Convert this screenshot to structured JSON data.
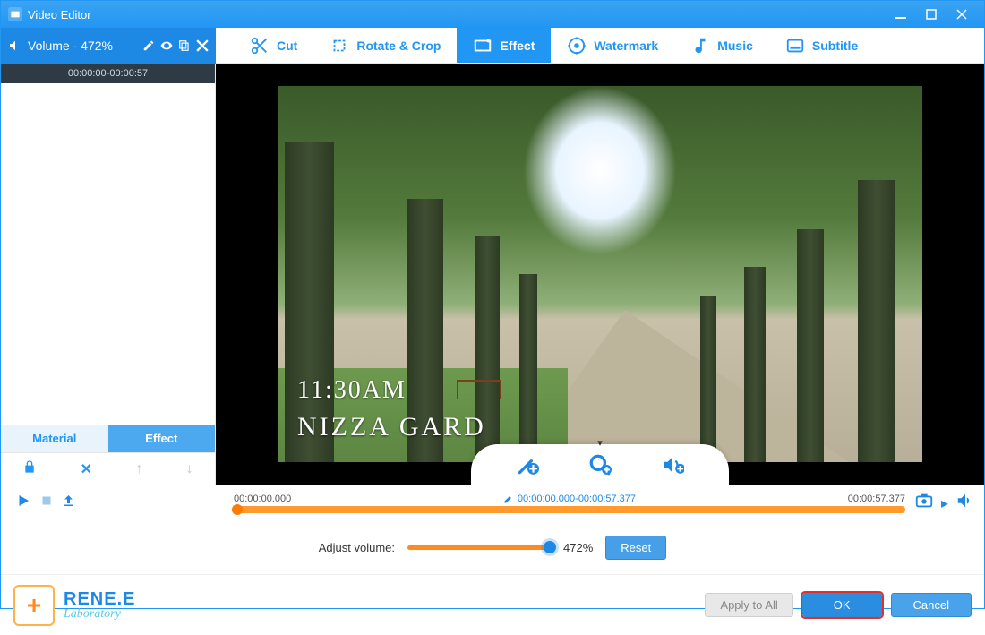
{
  "window": {
    "title": "Video Editor"
  },
  "sidebar": {
    "header": "Volume - 472%",
    "clip_time": "00:00:00-00:00:57",
    "tabs": {
      "material": "Material",
      "effect": "Effect"
    }
  },
  "toolbar": {
    "tabs": [
      {
        "label": "Cut"
      },
      {
        "label": "Rotate & Crop"
      },
      {
        "label": "Effect"
      },
      {
        "label": "Watermark"
      },
      {
        "label": "Music"
      },
      {
        "label": "Subtitle"
      }
    ]
  },
  "preview": {
    "overlay_time": "11:30AM",
    "overlay_place": "NIZZA GARD"
  },
  "timeline": {
    "start": "00:00:00.000",
    "range": "00:00:00.000-00:00:57.377",
    "end": "00:00:57.377"
  },
  "volume": {
    "label": "Adjust volume:",
    "value": "472%",
    "reset": "Reset"
  },
  "footer": {
    "brand1": "RENE.E",
    "brand2": "Laboratory",
    "apply_all": "Apply to All",
    "ok": "OK",
    "cancel": "Cancel"
  }
}
